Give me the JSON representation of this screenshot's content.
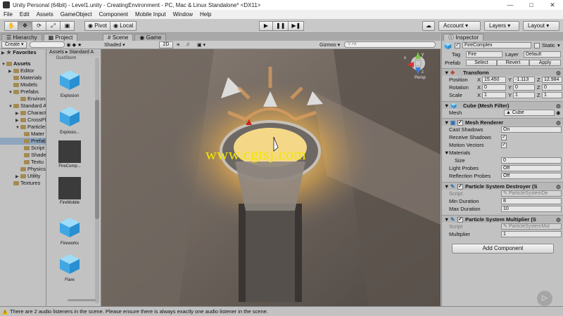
{
  "window": {
    "title": "Unity Personal (64bit) - Level1.unity - CreatingEnvironment - PC, Mac & Linux Standalone* <DX11>"
  },
  "menu": [
    "File",
    "Edit",
    "Assets",
    "GameObject",
    "Component",
    "Mobile Input",
    "Window",
    "Help"
  ],
  "toolbar": {
    "pivot": "Pivot",
    "local": "Local",
    "account": "Account",
    "layers": "Layers",
    "layout": "Layout"
  },
  "hierarchy": {
    "tab": "Hierarchy",
    "create": "Create",
    "favorites": "Favorites",
    "assets": "Assets",
    "items": [
      "Editor",
      "Materials",
      "Models",
      "Prefabs",
      "Environ",
      "Standard A",
      "Charact",
      "CrossPla",
      "ParticleS",
      "Mater",
      "Prefab",
      "Script",
      "Shade",
      "Textu",
      "PhysicsM",
      "Utility",
      "Textures"
    ]
  },
  "project": {
    "tab": "Project",
    "breadcrumb": "Assets ▸ Standard A",
    "top_label": "DustStorm",
    "assets": [
      "Explosion",
      "Explosio...",
      "FireComp...",
      "FireMobile",
      "Fireworks",
      "Flare"
    ]
  },
  "scene": {
    "tab_scene": "Scene",
    "tab_game": "Game",
    "shading": "Shaded",
    "mode2d": "2D",
    "gizmos": "Gizmos",
    "search_placeholder": "All",
    "persp": "Persp",
    "watermark": "www.cgtsj.com",
    "axis_y": "y",
    "axis_x": "x",
    "axis_z": "z"
  },
  "inspector": {
    "tab": "Inspector",
    "object_name": "FireComplex",
    "static_label": "Static",
    "tag_label": "Tag",
    "tag_value": "Fire",
    "layer_label": "Layer",
    "layer_value": "Default",
    "prefab_label": "Prefab",
    "prefab_select": "Select",
    "prefab_revert": "Revert",
    "prefab_apply": "Apply",
    "transform": {
      "title": "Transform",
      "position_label": "Position",
      "rotation_label": "Rotation",
      "scale_label": "Scale",
      "position": [
        "15.450",
        "-1.113",
        "12.984"
      ],
      "rotation": [
        "0",
        "0",
        "0"
      ],
      "scale": [
        "1",
        "1",
        "1"
      ]
    },
    "mesh_filter": {
      "title": "Cube (Mesh Filter)",
      "mesh_label": "Mesh",
      "mesh_value": "Cube"
    },
    "mesh_renderer": {
      "title": "Mesh Renderer",
      "cast_shadows_label": "Cast Shadows",
      "cast_shadows_value": "On",
      "receive_shadows_label": "Receive Shadows",
      "motion_vectors_label": "Motion Vectors",
      "materials_label": "Materials",
      "size_label": "Size",
      "size_value": "0",
      "light_probes_label": "Light Probes",
      "light_probes_value": "Off",
      "reflection_probes_label": "Reflection Probes",
      "reflection_probes_value": "Off"
    },
    "destroyer": {
      "title": "Particle System Destroyer (S",
      "script_label": "Script",
      "script_value": "ParticleSystemDe",
      "min_label": "Min Duration",
      "min_value": "8",
      "max_label": "Max Duration",
      "max_value": "10"
    },
    "multiplier": {
      "title": "Particle System Multiplier (S",
      "script_label": "Script",
      "script_value": "ParticleSystemMul",
      "mult_label": "Multiplier",
      "mult_value": "1"
    },
    "add_component": "Add Component"
  },
  "status": {
    "message": "There are 2 audio listeners in the scene. Please ensure there is always exactly one audio listener in the scene."
  },
  "colors": {
    "accent_select": "#8fa5be",
    "watermark": "#f2e600",
    "panel": "#c2c2c2"
  }
}
